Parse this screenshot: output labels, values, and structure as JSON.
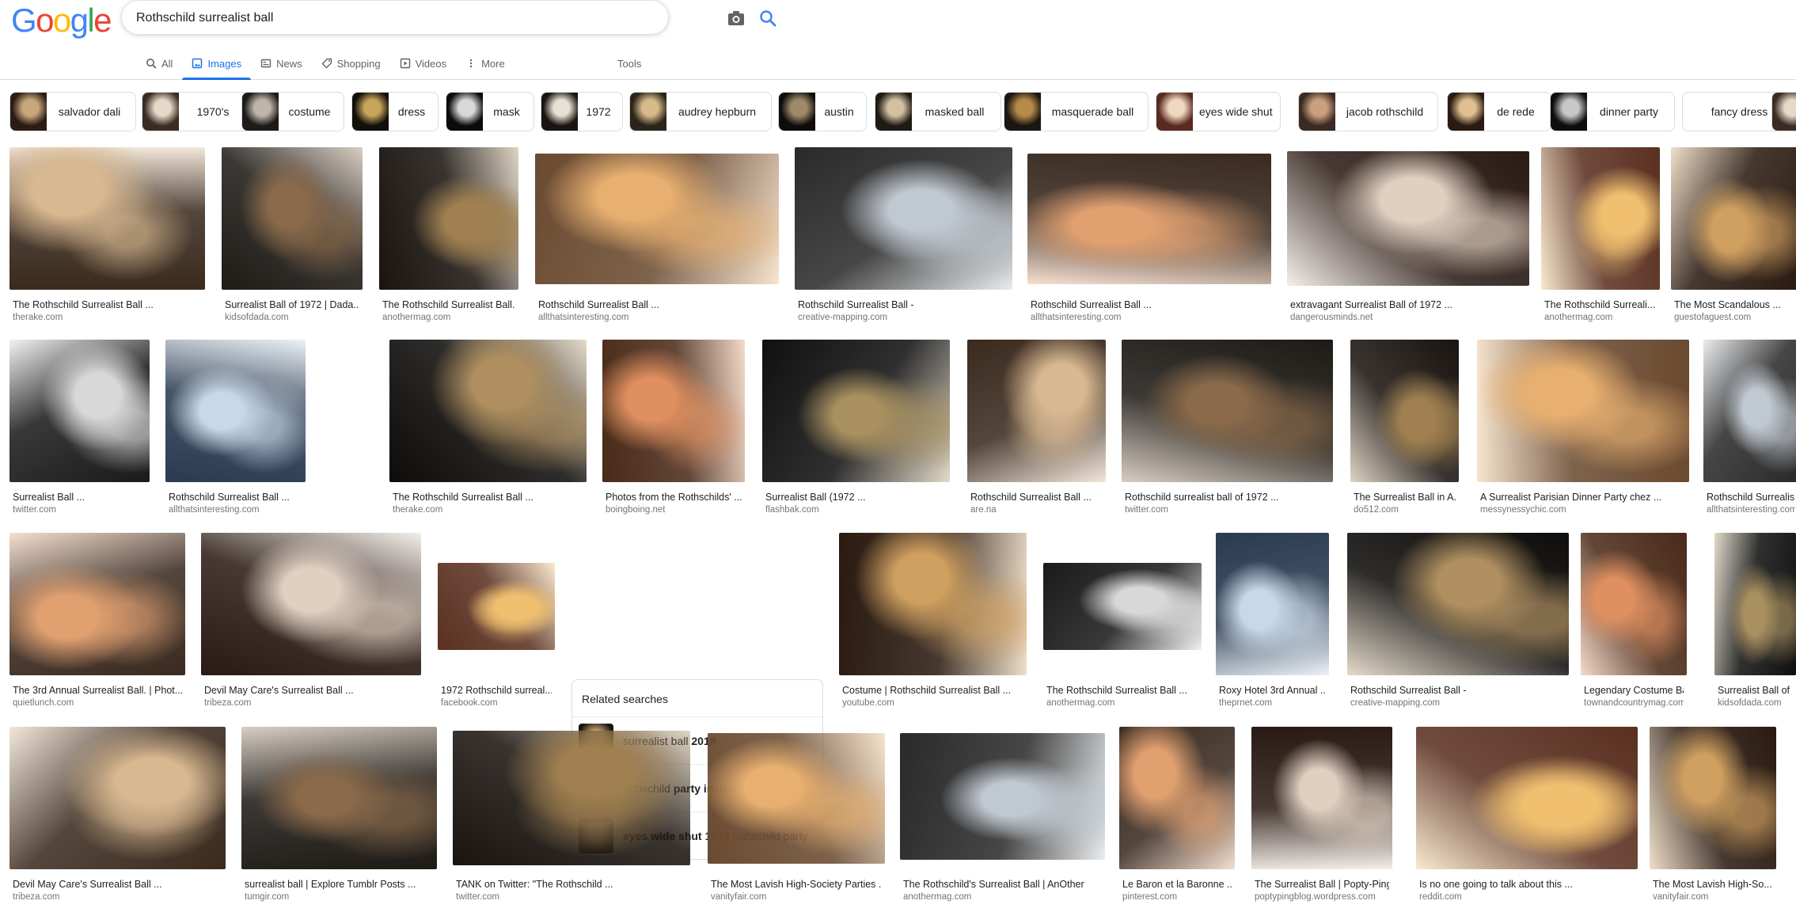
{
  "search": {
    "query": "Rothschild surrealist ball"
  },
  "logo": {
    "text": "Google",
    "colors": [
      "#4285f4",
      "#ea4335",
      "#fbbc05",
      "#4285f4",
      "#34a853",
      "#ea4335"
    ]
  },
  "tabs": [
    {
      "label": "All",
      "icon": "search-icon",
      "active": false
    },
    {
      "label": "Images",
      "icon": "image-icon",
      "active": true
    },
    {
      "label": "News",
      "icon": "news-icon",
      "active": false
    },
    {
      "label": "Shopping",
      "icon": "tag-icon",
      "active": false
    },
    {
      "label": "Videos",
      "icon": "play-icon",
      "active": false
    },
    {
      "label": "More",
      "icon": "dots-vertical-icon",
      "active": false
    }
  ],
  "tools_label": "Tools",
  "chips": [
    "salvador dali",
    "1970's",
    "costume",
    "dress",
    "mask",
    "1972",
    "audrey hepburn",
    "austin",
    "masked ball",
    "masquerade ball",
    "eyes wide shut",
    "jacob rothschild",
    "de rede",
    "dinner party",
    "fancy dress"
  ],
  "rows": [
    [
      {
        "title": "The Rothschild Surrealist Ball ...",
        "source": "therake.com"
      },
      {
        "title": "Surrealist Ball of 1972 | Dada...",
        "source": "kidsofdada.com"
      },
      {
        "title": "The Rothschild Surrealist Ball...",
        "source": "anothermag.com"
      },
      {
        "title": "Rothschild Surrealist Ball ...",
        "source": "allthatsinteresting.com"
      },
      {
        "title": "Rothschild Surrealist Ball -",
        "source": "creative-mapping.com"
      },
      {
        "title": "Rothschild Surrealist Ball ...",
        "source": "allthatsinteresting.com"
      },
      {
        "title": "extravagant Surrealist Ball of 1972 ...",
        "source": "dangerousminds.net"
      },
      {
        "title": "The Rothschild Surreali...",
        "source": "anothermag.com"
      },
      {
        "title": "The Most Scandalous ...",
        "source": "guestofaguest.com"
      }
    ],
    [
      {
        "title": "Surrealist Ball ...",
        "source": "twitter.com"
      },
      {
        "title": "Rothschild Surrealist Ball ...",
        "source": "allthatsinteresting.com"
      },
      {
        "title": "The Rothschild Surrealist Ball ...",
        "source": "therake.com"
      },
      {
        "title": "Photos from the Rothschilds' ...",
        "source": "boingboing.net"
      },
      {
        "title": "Surrealist Ball (1972 ...",
        "source": "flashbak.com"
      },
      {
        "title": "Rothschild Surrealist Ball ...",
        "source": "are.na"
      },
      {
        "title": "Rothschild surrealist ball of 1972 ...",
        "source": "twitter.com"
      },
      {
        "title": "The Surrealist Ball in A...",
        "source": "do512.com"
      },
      {
        "title": "A Surrealist Parisian Dinner Party chez ...",
        "source": "messynessychic.com"
      },
      {
        "title": "Rothschild Surrealis...",
        "source": "allthatsinteresting.com"
      }
    ],
    [
      {
        "title": "The 3rd Annual Surrealist Ball. | Phot...",
        "source": "quietlunch.com"
      },
      {
        "title": "Devil May Care's Surrealist Ball ...",
        "source": "tribeza.com"
      },
      {
        "title": "1972 Rothschild surreal...",
        "source": "facebook.com"
      },
      {
        "title": "Costume | Rothschild Surrealist Ball ...",
        "source": "youtube.com"
      },
      {
        "title": "The Rothschild Surrealist Ball ...",
        "source": "anothermag.com"
      },
      {
        "title": "Roxy Hotel 3rd Annual ...",
        "source": "theprnet.com"
      },
      {
        "title": "Rothschild Surrealist Ball -",
        "source": "creative-mapping.com"
      },
      {
        "title": "Legendary Costume Ba...",
        "source": "townandcountrymag.com"
      },
      {
        "title": "Surrealist Ball of ...",
        "source": "kidsofdada.com"
      }
    ],
    [
      {
        "title": "Devil May Care's Surrealist Ball ...",
        "source": "tribeza.com"
      },
      {
        "title": "surrealist ball | Explore Tumblr Posts ...",
        "source": "tumgir.com"
      },
      {
        "title": "TANK on Twitter: \"The Rothschild ...",
        "source": "twitter.com"
      },
      {
        "title": "The Most Lavish High-Society Parties ...",
        "source": "vanityfair.com"
      },
      {
        "title": "The Rothschild's Surrealist Ball | AnOther",
        "source": "anothermag.com"
      },
      {
        "title": "Le Baron et la Baronne ...",
        "source": "pinterest.com"
      },
      {
        "title": "The Surrealist Ball | Popty-Ping",
        "source": "poptypingblog.wordpress.com"
      },
      {
        "title": "Is no one going to talk about this ...",
        "source": "reddit.com"
      },
      {
        "title": "The Most Lavish High-So...",
        "source": "vanityfair.com"
      }
    ]
  ],
  "related": {
    "title": "Related searches",
    "items": [
      {
        "plain": "surrealist ball ",
        "bold": "2018",
        "suffix": ""
      },
      {
        "plain": "rothschild ",
        "bold": "party invitation",
        "suffix": ""
      },
      {
        "plain": "",
        "bold": "eyes wide shut 1972",
        "suffix": " rothschild party"
      }
    ]
  }
}
